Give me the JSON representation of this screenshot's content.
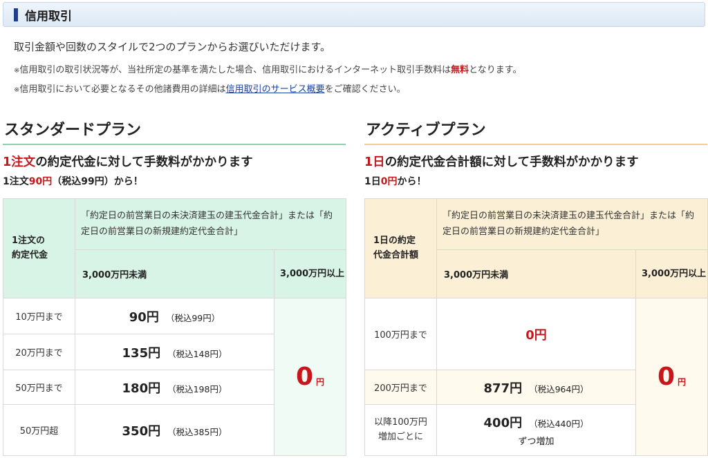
{
  "header": {
    "title": "信用取引"
  },
  "intro": {
    "lead": "取引金額や回数のスタイルで2つのプランからお選びいただけます。",
    "note1_prefix": "※",
    "note1_before": "信用取引の取引状況等が、当社所定の基準を満たした場合、信用取引におけるインターネット取引手数料は",
    "note1_free": "無料",
    "note1_after": "となります。",
    "note2_prefix": "※",
    "note2_before": "信用取引において必要となるその他諸費用の詳細は",
    "note2_link": "信用取引のサービス概要",
    "note2_after": "をご確認ください。"
  },
  "standard": {
    "title": "スタンダードプラン",
    "headline_red": "1注文",
    "headline_rest": "の約定代金に対して手数料がかかります",
    "sub_before": "1注文",
    "sub_red": "90円",
    "sub_after": "（税込99円）から！",
    "table": {
      "row_header": "1注文の\n約定代金",
      "desc": "「約定日の前営業日の未決済建玉の建玉代金合計」または「約定日の前営業日の新規建約定代金合計」",
      "band1": "3,000万円未満",
      "band2": "3,000万円以上",
      "cap_value": "0",
      "cap_unit": "円",
      "rows": [
        {
          "label": "10万円まで",
          "amount": "90円",
          "tax": "（税込99円）"
        },
        {
          "label": "20万円まで",
          "amount": "135円",
          "tax": "（税込148円）"
        },
        {
          "label": "50万円まで",
          "amount": "180円",
          "tax": "（税込198円）"
        },
        {
          "label": "50万円超",
          "amount": "350円",
          "tax": "（税込385円）"
        }
      ]
    }
  },
  "active": {
    "title": "アクティブプラン",
    "headline_red": "1日",
    "headline_rest": "の約定代金合計額に対して手数料がかかります",
    "sub_before": "1日",
    "sub_red": "0円",
    "sub_after": "から！",
    "table": {
      "row_header": "1日の約定\n代金合計額",
      "desc": "「約定日の前営業日の未決済建玉の建玉代金合計」または「約定日の前営業日の新規建約定代金合計」",
      "band1": "3,000万円未満",
      "band2": "3,000万円以上",
      "cap_value": "0",
      "cap_unit": "円",
      "rows": [
        {
          "label": "100万円まで",
          "amount": "0円",
          "tax": ""
        },
        {
          "label": "200万円まで",
          "amount": "877円",
          "tax": "（税込964円）"
        },
        {
          "label": "以降100万円\n増加ごとに",
          "amount": "400円",
          "tax": "（税込440円）",
          "extra": "ずつ増加"
        }
      ]
    }
  }
}
